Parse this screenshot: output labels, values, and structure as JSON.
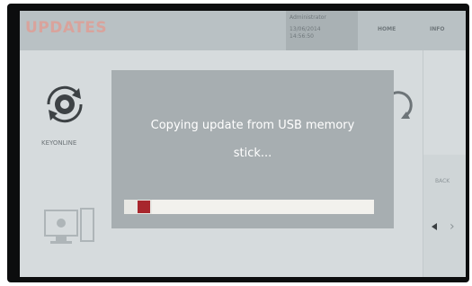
{
  "header": {
    "title": "UPDATES",
    "user_name": "Administrator",
    "date": "13/06/2014",
    "time": "14:56:50",
    "nav": [
      "HOME",
      "INFO"
    ]
  },
  "tiles": [
    {
      "label": "KEYONLINE",
      "icon": "keyonline-icon"
    },
    {
      "label": "",
      "icon": "computer-icon"
    }
  ],
  "side": {
    "back_label": "BACK",
    "nav_icons": [
      "arrow-left-icon",
      "arrow-right-icon"
    ]
  },
  "dialog": {
    "message_line1": "Copying update from USB memory",
    "message_line2": "stick...",
    "progress_fraction": 0.11
  },
  "colors": {
    "accent": "#a8272d",
    "title": "#d9a39c",
    "dialog_bg": "#a7aeb1"
  }
}
